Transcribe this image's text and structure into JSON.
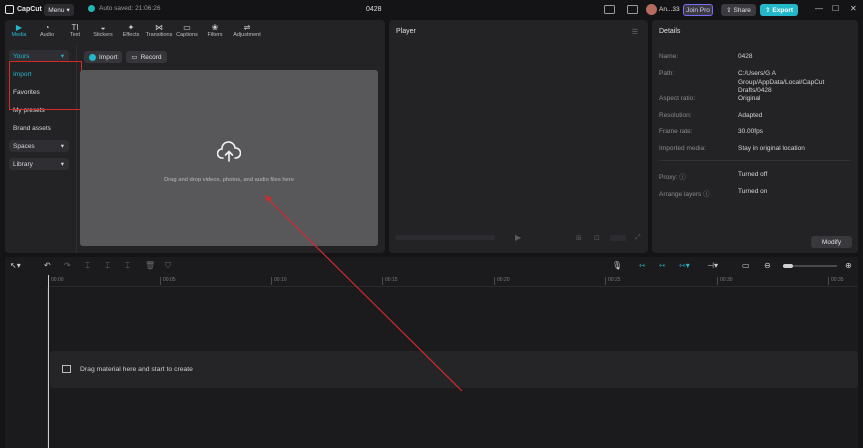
{
  "titlebar": {
    "app_name": "CapCut",
    "menu_label": "Menu",
    "autosave": "Auto saved: 21:06:26",
    "project_title": "0428",
    "username": "An...33",
    "join_pro": "Join Pro",
    "share": "Share",
    "export": "Export",
    "minimize": "—",
    "maximize": "☐",
    "close": "✕"
  },
  "toolbar_tabs": [
    {
      "label": "Media",
      "icon": "▶",
      "active": true
    },
    {
      "label": "Audio",
      "icon": "◔",
      "active": false
    },
    {
      "label": "Text",
      "icon": "TI",
      "active": false
    },
    {
      "label": "Stickers",
      "icon": "◒",
      "active": false
    },
    {
      "label": "Effects",
      "icon": "✦",
      "active": false
    },
    {
      "label": "Transitions",
      "icon": "⋈",
      "active": false
    },
    {
      "label": "Captions",
      "icon": "▭",
      "active": false
    },
    {
      "label": "Filters",
      "icon": "❀",
      "active": false
    },
    {
      "label": "Adjustment",
      "icon": "⇌",
      "active": false
    }
  ],
  "sidebar": {
    "yours": "Yours",
    "import": "Import",
    "favorites": "Favorites",
    "my_presets": "My presets",
    "brand_assets": "Brand assets",
    "spaces": "Spaces",
    "library": "Library"
  },
  "media": {
    "import_button": "Import",
    "record_button": "Record",
    "dropzone_text": "Drag and drop videos, photos, and audio files here"
  },
  "player": {
    "title": "Player"
  },
  "details": {
    "title": "Details",
    "rows": [
      {
        "key": "Name:",
        "value": "0428"
      },
      {
        "key": "Path:",
        "value": "C:/Users/G A Group/AppData/Local/CapCut Drafts/0428"
      },
      {
        "key": "Aspect ratio:",
        "value": "Original"
      },
      {
        "key": "Resolution:",
        "value": "Adapted"
      },
      {
        "key": "Frame rate:",
        "value": "30.00fps"
      },
      {
        "key": "Imported media:",
        "value": "Stay in original location"
      },
      {
        "key": "Proxy: ⓘ",
        "value": "Turned off"
      },
      {
        "key": "Arrange layers ⓘ",
        "value": "Turned on"
      }
    ],
    "modify_button": "Modify"
  },
  "timeline": {
    "ruler_ticks": [
      "00:00",
      "00:05",
      "00:10",
      "00:15",
      "00:20",
      "00:25",
      "00:30",
      "00:35"
    ],
    "empty_track_text": "Drag material here and start to create"
  },
  "colors": {
    "accent": "#22b8c9",
    "annotation_red": "#d32a2a",
    "background": "#141416"
  }
}
